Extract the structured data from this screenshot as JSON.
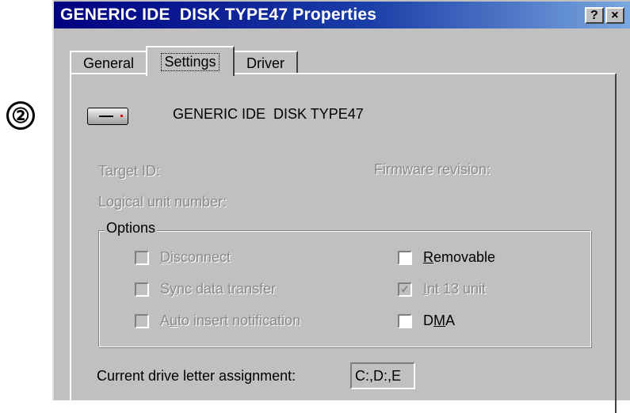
{
  "step_marker": "②",
  "window": {
    "title": "GENERIC IDE  DISK TYPE47 Properties",
    "help_button": "?",
    "close_button": "×"
  },
  "tabs": [
    {
      "label": "General",
      "active": false
    },
    {
      "label": "Settings",
      "active": true
    },
    {
      "label": "Driver",
      "active": false
    }
  ],
  "device": {
    "icon": "hard-disk-icon",
    "name": "GENERIC IDE  DISK TYPE47"
  },
  "info": {
    "target_id_label": "Target ID:",
    "firmware_revision_label": "Firmware revision:",
    "logical_unit_label": "Logical unit number:"
  },
  "options": {
    "label": "Options",
    "checkboxes": [
      {
        "pre": "",
        "mnemonic": "D",
        "post": "isconnect",
        "checked": false,
        "enabled": false
      },
      {
        "pre": "S",
        "mnemonic": "y",
        "post": "nc data transfer",
        "checked": false,
        "enabled": false
      },
      {
        "pre": "A",
        "mnemonic": "u",
        "post": "to insert notification",
        "checked": false,
        "enabled": false
      },
      {
        "pre": "",
        "mnemonic": "R",
        "post": "emovable",
        "checked": false,
        "enabled": true
      },
      {
        "pre": "",
        "mnemonic": "I",
        "post": "nt 13 unit",
        "checked": true,
        "enabled": false
      },
      {
        "pre": "D",
        "mnemonic": "M",
        "post": "A",
        "checked": false,
        "enabled": true
      }
    ]
  },
  "drive_letter": {
    "label": "Current drive letter assignment:",
    "value": "C:,D:,E"
  },
  "colors": {
    "face": "#c0c0c0",
    "title_start": "#000080",
    "title_end": "#7aa8e0",
    "disabled_text": "#8a8a8a"
  }
}
